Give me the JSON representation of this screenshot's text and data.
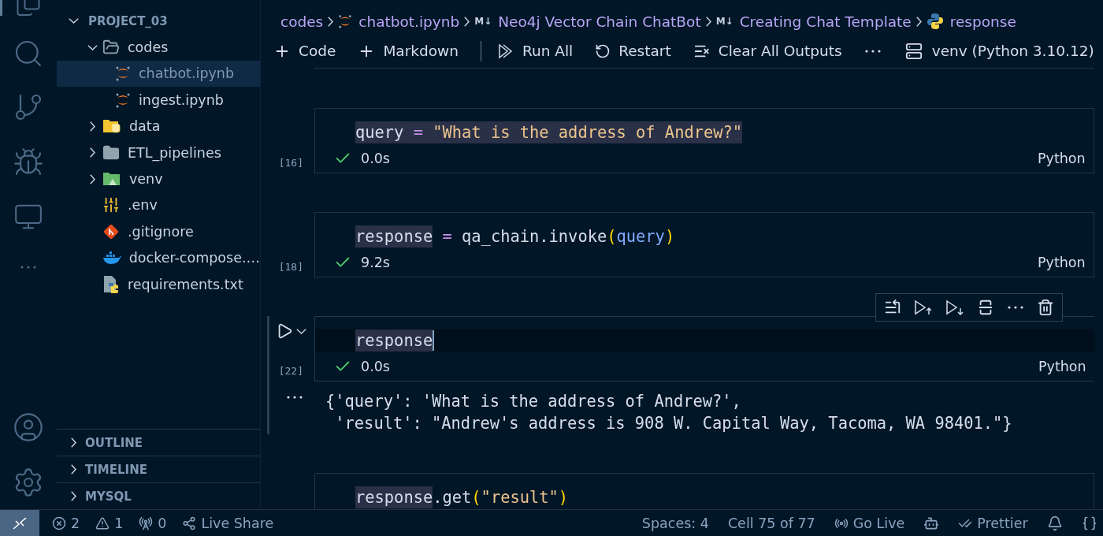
{
  "explorer": {
    "title": "PROJECT_03",
    "expanded": true,
    "items": [
      {
        "label": "codes",
        "kind": "folder",
        "expanded": true,
        "selected": false,
        "children": [
          {
            "label": "chatbot.ipynb",
            "kind": "notebook",
            "selected": true
          },
          {
            "label": "ingest.ipynb",
            "kind": "notebook",
            "selected": false
          }
        ]
      },
      {
        "label": "data",
        "kind": "data-folder",
        "expanded": false,
        "selected": false
      },
      {
        "label": "ETL_pipelines",
        "kind": "folder",
        "expanded": false,
        "selected": false
      },
      {
        "label": "venv",
        "kind": "env-folder",
        "expanded": false,
        "selected": false
      },
      {
        "label": ".env",
        "kind": "env-file",
        "selected": false
      },
      {
        "label": ".gitignore",
        "kind": "git-file",
        "selected": false
      },
      {
        "label": "docker-compose.…",
        "kind": "docker-file",
        "selected": false
      },
      {
        "label": "requirements.txt",
        "kind": "text-file",
        "selected": false
      }
    ]
  },
  "panels": [
    {
      "label": "OUTLINE",
      "expanded": false
    },
    {
      "label": "TIMELINE",
      "expanded": false
    },
    {
      "label": "MYSQL",
      "expanded": false
    }
  ],
  "breadcrumbs": [
    {
      "label": "codes",
      "kind": "folder"
    },
    {
      "label": "chatbot.ipynb",
      "kind": "notebook"
    },
    {
      "label": "Neo4j Vector Chain ChatBot",
      "kind": "markdown",
      "badge": "M↓"
    },
    {
      "label": "Creating Chat Template",
      "kind": "markdown",
      "badge": "M↓"
    },
    {
      "label": "response",
      "kind": "python"
    }
  ],
  "toolbar": [
    {
      "label": "Code",
      "kind": "add"
    },
    {
      "label": "Markdown",
      "kind": "add"
    },
    {
      "label": "Run All",
      "kind": "run-all"
    },
    {
      "label": "Restart",
      "kind": "restart"
    },
    {
      "label": "Clear All Outputs",
      "kind": "clear"
    },
    {
      "kind": "more"
    }
  ],
  "kernel": "venv (Python 3.10.12)",
  "cells": [
    {
      "count": "[16]",
      "focused": false,
      "succeeded": true,
      "time": "0.0s",
      "language": "Python",
      "code": [
        {
          "text": "query",
          "kind": "variable",
          "highlighted": true
        },
        {
          "text": " = ",
          "kind": "operator",
          "highlighted": true
        },
        {
          "text": "\"What is the address of Andrew?\"",
          "kind": "string",
          "highlighted": true
        }
      ]
    },
    {
      "count": "[18]",
      "focused": false,
      "succeeded": true,
      "time": "9.2s",
      "language": "Python",
      "code": [
        {
          "text": "response",
          "kind": "variable",
          "highlighted": true
        },
        {
          "text": " = ",
          "kind": "operator",
          "highlighted": false
        },
        {
          "text": "qa_chain.invoke",
          "kind": "variable",
          "highlighted": false
        },
        {
          "text": "(",
          "kind": "paren",
          "highlighted": false
        },
        {
          "text": "query",
          "kind": "parameter",
          "highlighted": false
        },
        {
          "text": ")",
          "kind": "paren",
          "highlighted": false
        }
      ]
    },
    {
      "count": "[22]",
      "focused": true,
      "succeeded": true,
      "time": "0.0s",
      "language": "Python",
      "code": [
        {
          "text": "response",
          "kind": "variable",
          "highlighted": true
        }
      ],
      "output": [
        "{'query': 'What is the address of Andrew?',",
        " 'result': \"Andrew's address is 908 W. Capital Way, Tacoma, WA 98401.\"}"
      ]
    },
    {
      "focused": false,
      "code": [
        {
          "text": "response",
          "kind": "variable",
          "highlighted": true
        },
        {
          "text": ".get",
          "kind": "variable",
          "highlighted": false
        },
        {
          "text": "(",
          "kind": "paren",
          "highlighted": false
        },
        {
          "text": "\"result\"",
          "kind": "string",
          "highlighted": false
        },
        {
          "text": ")",
          "kind": "paren",
          "highlighted": false
        }
      ]
    }
  ],
  "status_bar": {
    "left": [
      {
        "kind": "remote"
      },
      {
        "kind": "errors",
        "text": "2"
      },
      {
        "kind": "warnings",
        "text": "1"
      },
      {
        "kind": "ports",
        "text": "0"
      },
      {
        "kind": "live-share",
        "text": "Live Share"
      }
    ],
    "right": [
      {
        "kind": "text",
        "text": "Spaces: 4"
      },
      {
        "kind": "text",
        "text": "Cell 75 of 77"
      },
      {
        "kind": "go-live",
        "text": "Go Live"
      },
      {
        "kind": "copilot"
      },
      {
        "kind": "prettier",
        "text": "Prettier"
      },
      {
        "kind": "bell"
      },
      {
        "kind": "braces"
      }
    ]
  }
}
